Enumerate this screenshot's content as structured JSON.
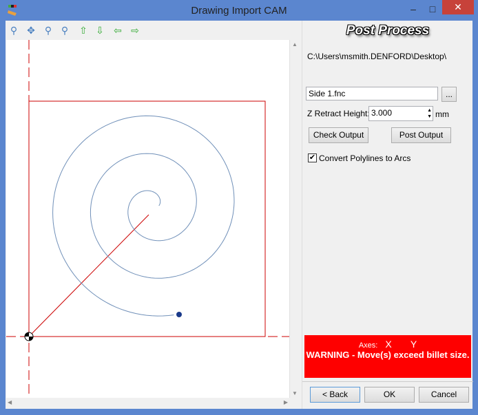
{
  "window": {
    "title": "Drawing Import CAM",
    "minimize": "–",
    "maximize": "□",
    "close": "✕"
  },
  "toolbar": {
    "icons": [
      "zoom-window-icon",
      "zoom-extents-icon",
      "zoom-in-icon",
      "zoom-out-icon",
      "pan-up-icon",
      "pan-down-icon",
      "pan-left-icon",
      "pan-right-icon"
    ]
  },
  "panel": {
    "heading": "Post Process",
    "path": "C:\\Users\\msmith.DENFORD\\Desktop\\",
    "filename": "Side 1.fnc",
    "browse": "...",
    "z_retract_label": "Z Retract Height:",
    "z_retract_value": "3.000",
    "z_unit": "mm",
    "check_output": "Check Output",
    "post_output": "Post Output",
    "convert_label": "Convert Polylines to Arcs",
    "convert_checked": true,
    "axes_label": "Axes:",
    "axis_x": "X",
    "axis_y": "Y",
    "warning": "WARNING - Move(s) exceed billet size.",
    "back": "< Back",
    "ok": "OK",
    "cancel": "Cancel"
  },
  "colors": {
    "toolpath": "#6f8fb8",
    "billet": "#cc0000",
    "warning_bg": "#fe0000"
  }
}
